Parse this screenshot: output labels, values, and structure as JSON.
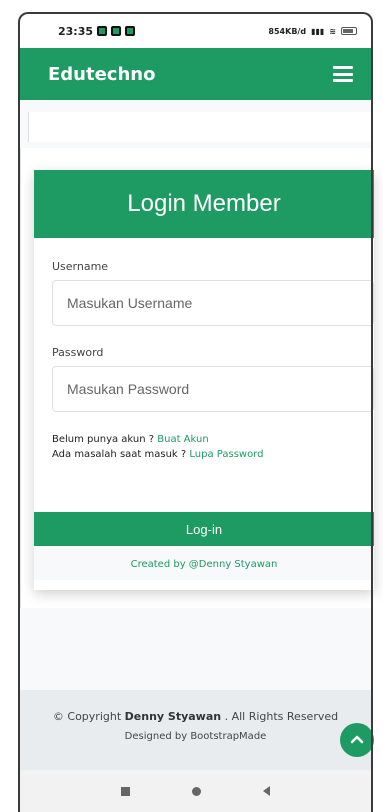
{
  "status": {
    "time": "23:35",
    "network": "854KB/d"
  },
  "navbar": {
    "brand": "Edutechno"
  },
  "login": {
    "title": "Login Member",
    "username_label": "Username",
    "username_placeholder": "Masukan Username",
    "password_label": "Password",
    "password_placeholder": "Masukan Password",
    "no_account_text": "Belum punya akun ? ",
    "register_link": "Buat Akun",
    "problem_text": "Ada masalah saat masuk ? ",
    "forgot_link": "Lupa Password",
    "submit_label": "Log-in",
    "created_by": "Created by @Denny Styawan"
  },
  "footer": {
    "copyright_prefix": "© Copyright ",
    "copyright_owner": "Denny Styawan",
    "copyright_suffix": " . All Rights Reserved",
    "designed_by": "Designed by BootstrapMade"
  },
  "colors": {
    "primary": "#1d9b63"
  }
}
